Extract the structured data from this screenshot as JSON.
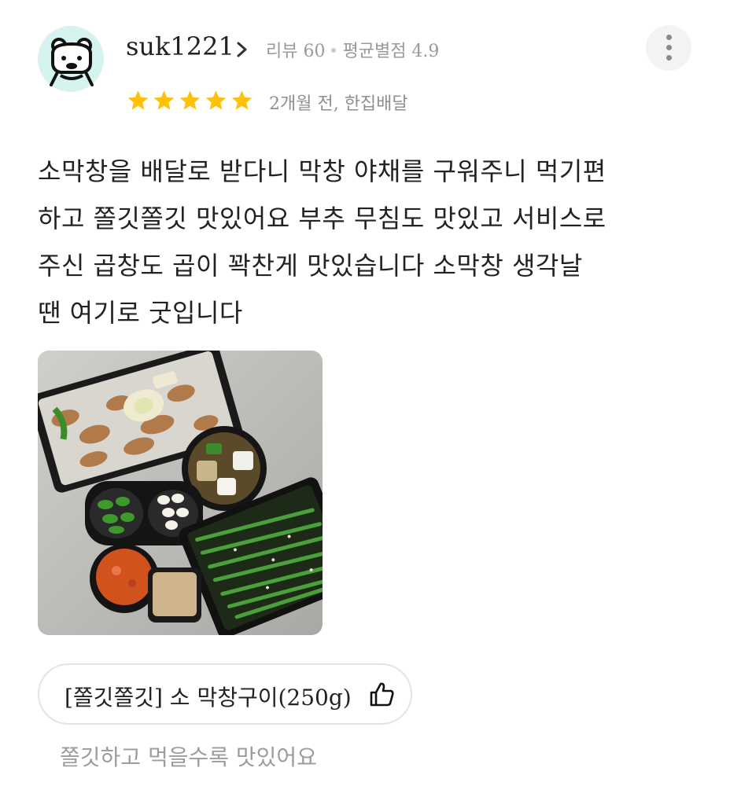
{
  "reviewer": {
    "username": "suk1221",
    "review_count_label": "리뷰 60",
    "avg_rating_label": "평균별점 4.9",
    "avatar_icon": "bear-face-icon",
    "avatar_bg": "#d5f4ef"
  },
  "more_menu": {
    "icon": "more-vertical-icon"
  },
  "rating": {
    "stars": 5,
    "max": 5,
    "color": "#ffc107"
  },
  "date_info": "2개월 전, 한집배달",
  "review": {
    "lines": [
      "소막창을 배달로 받다니 막창 야채를 구워주니 먹기편",
      "하고 쫄깃쫄깃 맛있어요 부추 무침도 맛있고 서비스로",
      "주신 곱창도 곱이 꽉찬게 맛있습니다 소막창 생각날",
      "땐 여기로 굿입니다"
    ]
  },
  "photo": {
    "subject": "food-photo"
  },
  "menu_tag": {
    "label": "[쫄깃쫄깃] 소 막창구이(250g)",
    "icon": "thumbs-up-icon"
  },
  "tag_comment": "쫄깃하고 먹을수록 맛있어요"
}
